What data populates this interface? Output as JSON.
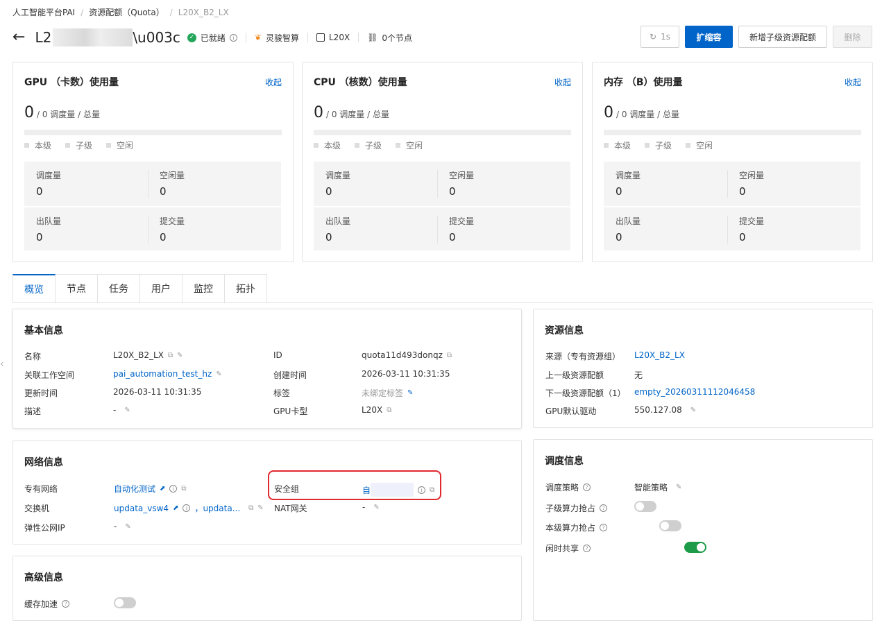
{
  "breadcrumb": {
    "items": [
      "人工智能平台PAI",
      "资源配额（Quota）",
      "L20X_B2_LX"
    ],
    "sep": "/"
  },
  "header": {
    "back": "←",
    "title_prefix": "L2",
    "title_suffix": "<",
    "status": "已就绪",
    "vendor": "灵骏智算",
    "gpu_type": "L20X",
    "nodes": "0个节点"
  },
  "actions": {
    "refresh": "1s",
    "scale": "扩缩容",
    "add_child": "新增子级资源配额",
    "delete": "删除"
  },
  "usage_cards": [
    {
      "title": "GPU （卡数）使用量",
      "fold": "收起",
      "value": "0",
      "sub": "/ 0 调度量 / 总量",
      "legend": [
        "本级",
        "子级",
        "空闲"
      ],
      "stats": [
        {
          "label": "调度量",
          "value": "0"
        },
        {
          "label": "空闲量",
          "value": "0"
        },
        {
          "label": "出队量",
          "value": "0"
        },
        {
          "label": "提交量",
          "value": "0"
        }
      ]
    },
    {
      "title": "CPU （核数）使用量",
      "fold": "收起",
      "value": "0",
      "sub": "/ 0 调度量 / 总量",
      "legend": [
        "本级",
        "子级",
        "空闲"
      ],
      "stats": [
        {
          "label": "调度量",
          "value": "0"
        },
        {
          "label": "空闲量",
          "value": "0"
        },
        {
          "label": "出队量",
          "value": "0"
        },
        {
          "label": "提交量",
          "value": "0"
        }
      ]
    },
    {
      "title": "内存 （B）使用量",
      "fold": "收起",
      "value": "0",
      "sub": "/ 0 调度量 / 总量",
      "legend": [
        "本级",
        "子级",
        "空闲"
      ],
      "stats": [
        {
          "label": "调度量",
          "value": "0"
        },
        {
          "label": "空闲量",
          "value": "0"
        },
        {
          "label": "出队量",
          "value": "0"
        },
        {
          "label": "提交量",
          "value": "0"
        }
      ]
    }
  ],
  "tabs": [
    "概览",
    "节点",
    "任务",
    "用户",
    "监控",
    "拓扑"
  ],
  "basic": {
    "title": "基本信息",
    "name_k": "名称",
    "name_v": "L20X_B2_LX",
    "ws_k": "关联工作空间",
    "ws_v": "pai_automation_test_hz",
    "upd_k": "更新时间",
    "upd_v": "2026-03-11 10:31:35",
    "desc_k": "描述",
    "desc_v": "-",
    "id_k": "ID",
    "id_v": "quota11d493donqz",
    "ct_k": "创建时间",
    "ct_v": "2026-03-11 10:31:35",
    "tag_k": "标签",
    "tag_v": "未绑定标签",
    "gpu_k": "GPU卡型",
    "gpu_v": "L20X"
  },
  "resource": {
    "title": "资源信息",
    "src_k": "来源（专有资源组）",
    "src_v": "L20X_B2_LX",
    "parent_k": "上一级资源配额",
    "parent_v": "无",
    "child_k": "下一级资源配额（1）",
    "child_v": "empty_20260311112046458",
    "drv_k": "GPU默认驱动",
    "drv_v": "550.127.08"
  },
  "network": {
    "title": "网络信息",
    "vpc_k": "专有网络",
    "vpc_v": "自动化测试",
    "sw_k": "交换机",
    "sw_v1": "updata_vsw4",
    "sw_v2": "，updata...",
    "eip_k": "弹性公网IP",
    "eip_v": "-",
    "sg_k": "安全组",
    "sg_v": "自",
    "nat_k": "NAT网关",
    "nat_v": "-"
  },
  "schedule": {
    "title": "调度信息",
    "policy_k": "调度策略",
    "policy_v": "智能策略",
    "child_pre_k": "子级算力抢占",
    "child_pre_on": false,
    "self_pre_k": "本级算力抢占",
    "self_pre_on": false,
    "idle_k": "闲时共享",
    "idle_on": true
  },
  "advanced": {
    "title": "高级信息",
    "cache_k": "缓存加速",
    "cache_on": false
  },
  "colors": {
    "primary": "#0064c8",
    "success": "#23a55a",
    "toggle_on": "#1d9b48",
    "highlight": "#e0282e"
  }
}
